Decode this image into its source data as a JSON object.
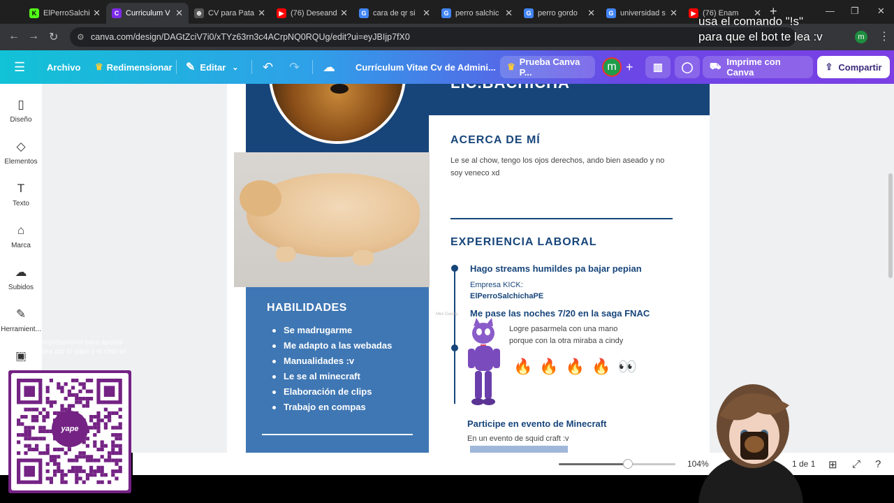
{
  "browser": {
    "tabs": [
      {
        "title": "ElPerroSalchi",
        "fav_color": "#53fc18",
        "fav_text": "K"
      },
      {
        "title": "Curriculum V",
        "fav_color": "#7d2ae8",
        "fav_text": "C"
      },
      {
        "title": "CV para Pata",
        "fav_color": "#555555",
        "fav_text": "⊕"
      },
      {
        "title": "(76) Deseand",
        "fav_color": "#ff0000",
        "fav_text": "▶"
      },
      {
        "title": "cara de qr si",
        "fav_color": "#4285f4",
        "fav_text": "G"
      },
      {
        "title": "perro salchic",
        "fav_color": "#4285f4",
        "fav_text": "G"
      },
      {
        "title": "perro gordo",
        "fav_color": "#4285f4",
        "fav_text": "G"
      },
      {
        "title": "universidad s",
        "fav_color": "#4285f4",
        "fav_text": "G"
      },
      {
        "title": "(76) Enam",
        "fav_color": "#ff0000",
        "fav_text": "▶"
      }
    ],
    "url": "canva.com/design/DAGtZciV7i0/xTYz63rn3c4ACrpNQ0RQUg/edit?ui=eyJBIjp7fX0",
    "profile_initial": "m"
  },
  "overlay": {
    "cmd_line1": "usa el comando \"!s\"",
    "cmd_line2": "para que el bot te lea :v",
    "qr_caption": "sólo lra completamente para aportar el donal osea por el yape y el chat se tomar",
    "qr_logo": "yape"
  },
  "canva": {
    "menu": {
      "archivo": "Archivo",
      "redimensionar": "Redimensionar",
      "editar": "Editar",
      "doc_title": "Currículum Vitae Cv de Admini...",
      "trial": "Prueba Canva P...",
      "avatar_initial": "m",
      "print": "Imprime con Canva",
      "share": "Compartir"
    },
    "sidebar": [
      {
        "label": "Diseño",
        "icon": "▯"
      },
      {
        "label": "Elementos",
        "icon": "◇"
      },
      {
        "label": "Texto",
        "icon": "T"
      },
      {
        "label": "Marca",
        "icon": "⌂"
      },
      {
        "label": "Subidos",
        "icon": "☁"
      },
      {
        "label": "Herramient...",
        "icon": "✎"
      }
    ],
    "status": {
      "zoom": "104%",
      "zoom_fraction": 0.59,
      "page": "1 de 1"
    }
  },
  "cv": {
    "name_partial": "LIC.BACHICHA",
    "about_title": "ACERCA DE MÍ",
    "about_text": "Le se al chow, tengo los ojos derechos, ando bien aseado y no soy veneco xd",
    "experience_title": "EXPERIENCIA LABORAL",
    "jobs": [
      {
        "title": "Hago streams humildes pa bajar pepian",
        "company_label": "Empresa KICK:",
        "company": "ElPerroSalchichaPE"
      },
      {
        "title": "Me pase las noches 7/20 en la saga FNAC",
        "desc_line1": "Logre pasarmela con una mano",
        "desc_line2": "porque con la otra miraba a cindy",
        "emojis": "🔥🔥🔥🔥👀"
      },
      {
        "title": "Participe en evento de Minecraft",
        "desc": "En un evento de squid craft :v"
      }
    ],
    "skills_title": "HABILIDADES",
    "skills": [
      "Se madrugarme",
      "Me adapto a las webadas",
      "Manualidades :v",
      "Le se al minecraft",
      "Elaboración de clips",
      "Trabajo en compas"
    ]
  }
}
